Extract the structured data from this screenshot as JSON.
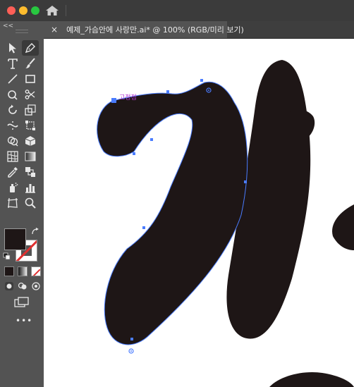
{
  "window": {
    "traffic_lights": [
      {
        "name": "close",
        "color": "#ff5f57"
      },
      {
        "name": "minimize",
        "color": "#febc2e"
      },
      {
        "name": "zoom",
        "color": "#28c840"
      }
    ]
  },
  "toolbar": {
    "collapse_label": "<<",
    "more_label": "•••"
  },
  "document_tab": {
    "close_label": "×",
    "title": "예제_가슴안에 사랑만.ai* @ 100% (RGB/미리 보기)"
  },
  "canvas": {
    "anchor_label": "고정점",
    "glyph_fill": "#1e1616",
    "path_color": "#4a7cff"
  },
  "colors": {
    "fill": "#1e1616",
    "stroke_none_indicator": "#e03030",
    "accent": "#4a7cff"
  }
}
